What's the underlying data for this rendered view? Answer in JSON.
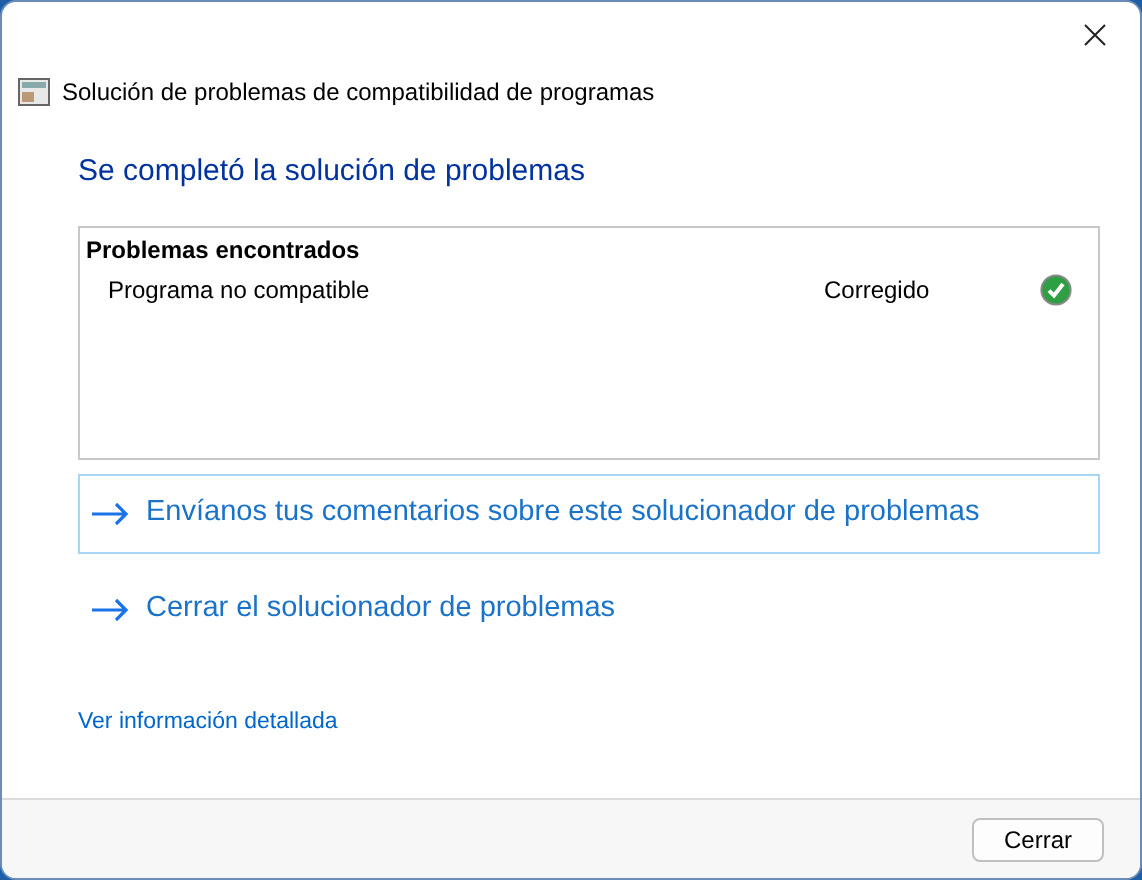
{
  "window": {
    "title": "Solución de problemas de compatibilidad de programas"
  },
  "heading": "Se completó la solución de problemas",
  "problems": {
    "title": "Problemas encontrados",
    "items": [
      {
        "name": "Programa no compatible",
        "status": "Corregido",
        "fixed": true
      }
    ]
  },
  "actions": [
    {
      "label": "Envíanos tus comentarios sobre este solucionador de problemas",
      "selected": true
    },
    {
      "label": "Cerrar el solucionador de problemas",
      "selected": false
    }
  ],
  "details_link": "Ver información detallada",
  "buttons": [
    "Cerrar"
  ]
}
